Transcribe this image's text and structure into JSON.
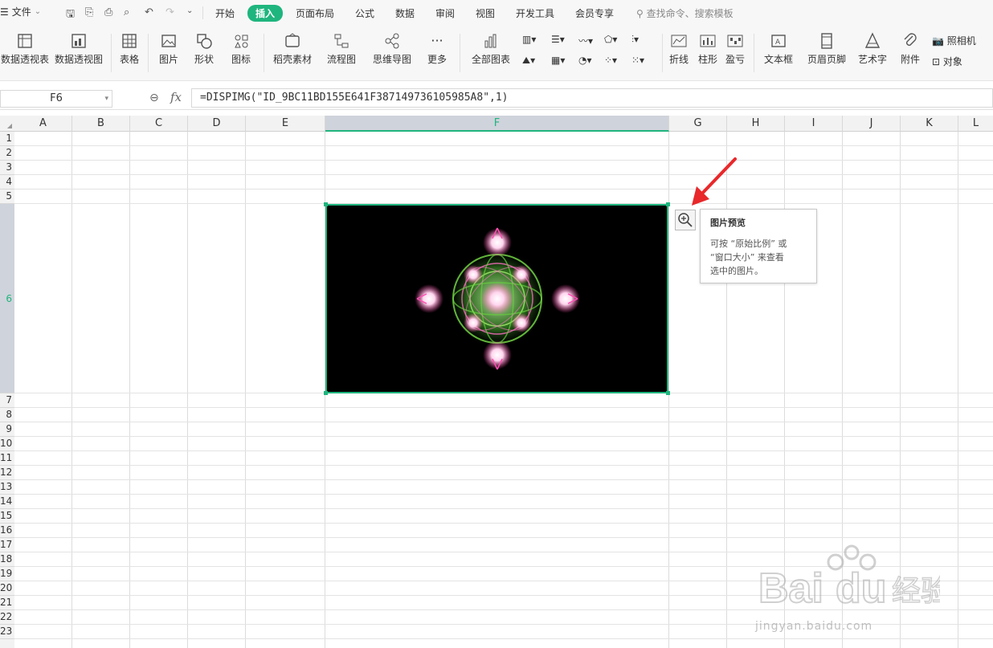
{
  "menu": {
    "file_label": "文件",
    "tabs": [
      "开始",
      "插入",
      "页面布局",
      "公式",
      "数据",
      "审阅",
      "视图",
      "开发工具",
      "会员专享"
    ],
    "active_tab": "插入",
    "search_placeholder": "查找命令、搜索模板"
  },
  "ribbon": {
    "buttons": [
      "数据透视表",
      "数据透视图",
      "表格",
      "图片",
      "形状",
      "图标",
      "稻壳素材",
      "流程图",
      "思维导图",
      "更多",
      "全部图表",
      "折线",
      "柱形",
      "盈亏",
      "文本框",
      "页眉页脚",
      "艺术字",
      "附件"
    ],
    "camera_label": "照相机",
    "object_label": "对象"
  },
  "formula_bar": {
    "cell_ref": "F6",
    "fx_label": "fx",
    "formula": "=DISPIMG(\"ID_9BC11BD155E641F387149736105985A8\",1)"
  },
  "grid": {
    "columns": [
      "A",
      "B",
      "C",
      "D",
      "E",
      "F",
      "G",
      "H",
      "I",
      "J",
      "K",
      "L"
    ],
    "selected_column": "F",
    "rows": [
      "1",
      "2",
      "3",
      "4",
      "5",
      "6",
      "7",
      "8",
      "9",
      "10",
      "11",
      "12",
      "13",
      "14",
      "15",
      "16",
      "17",
      "18",
      "19",
      "20",
      "21",
      "22",
      "23"
    ],
    "selected_row": "6"
  },
  "tooltip": {
    "title": "图片预览",
    "line1": "可按 “原始比例” 或",
    "line2": "“窗口大小” 来查看",
    "line3": "选中的图片。"
  },
  "watermark": "jingyan.baidu.com",
  "colors": {
    "accent": "#1fb57e",
    "arrow": "#e8282b"
  }
}
